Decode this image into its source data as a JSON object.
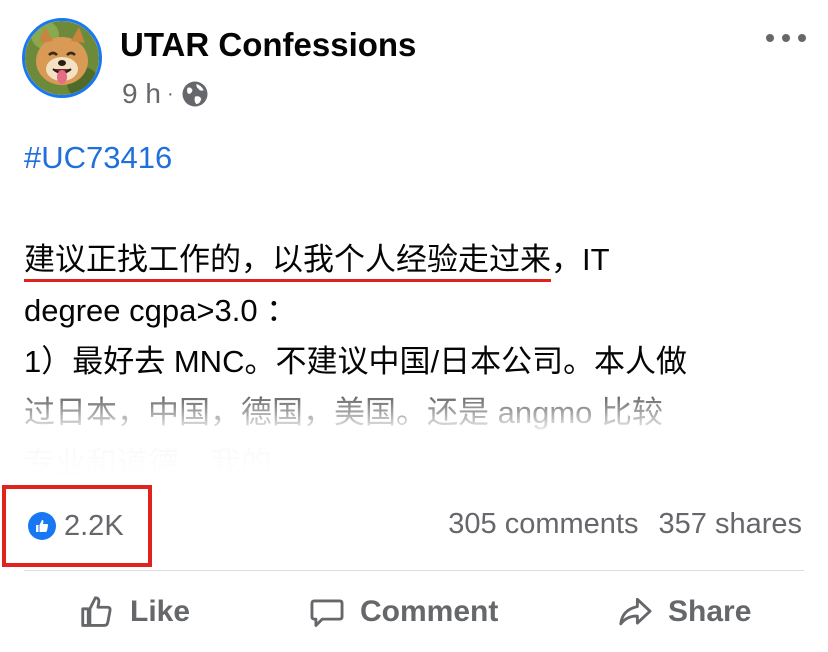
{
  "header": {
    "page_name": "UTAR Confessions",
    "time": "9 h",
    "separator": "·",
    "privacy_icon": "globe-icon",
    "more_icon": "more-options-icon"
  },
  "body": {
    "hashtag": "#UC73416",
    "lines": [
      "建议正找工作的，以我个人经验走过来",
      "，IT",
      "degree cgpa>3.0 ：",
      "1）最好去 MNC。不建议中国/日本公司。本人做",
      "过日本，中国，德国，美国。还是 angmo 比较",
      "专业和道德，我的..."
    ]
  },
  "stats": {
    "reaction_icon": "like-icon",
    "reactions": "2.2K",
    "comments": "305 comments",
    "shares": "357 shares"
  },
  "actions": {
    "like": "Like",
    "comment": "Comment",
    "share": "Share"
  },
  "colors": {
    "link": "#216fdb",
    "brand": "#1877f2",
    "highlight": "#e1231f",
    "muted": "#65676b"
  }
}
